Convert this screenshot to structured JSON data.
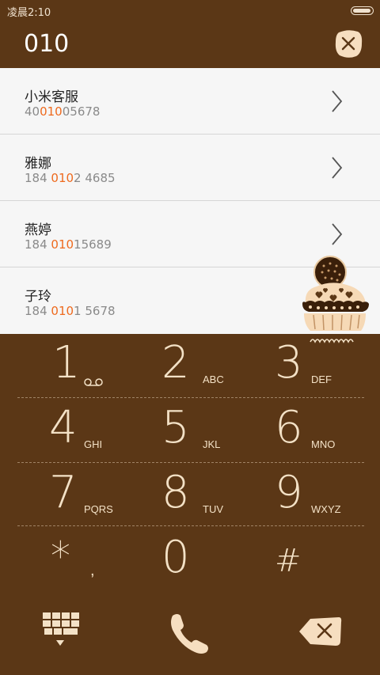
{
  "status": {
    "time": "凌晨2:10"
  },
  "search": {
    "query": "010"
  },
  "results": [
    {
      "name": "小米客服",
      "number_pre": "40",
      "number_match": "010",
      "number_post": "05678"
    },
    {
      "name": "雅娜",
      "number_pre": "184 ",
      "number_match": "010",
      "number_post": "2 4685"
    },
    {
      "name": "燕婷",
      "number_pre": "184 ",
      "number_match": "010",
      "number_post": "15689"
    },
    {
      "name": "子玲",
      "number_pre": "184 ",
      "number_match": "010",
      "number_post": "1 5678"
    }
  ],
  "keypad": {
    "k1": {
      "digit": "1",
      "letters": ""
    },
    "k2": {
      "digit": "2",
      "letters": "ABC"
    },
    "k3": {
      "digit": "3",
      "letters": "DEF"
    },
    "k4": {
      "digit": "4",
      "letters": "GHI"
    },
    "k5": {
      "digit": "5",
      "letters": "JKL"
    },
    "k6": {
      "digit": "6",
      "letters": "MNO"
    },
    "k7": {
      "digit": "7",
      "letters": "PQRS"
    },
    "k8": {
      "digit": "8",
      "letters": "TUV"
    },
    "k9": {
      "digit": "9",
      "letters": "WXYZ"
    },
    "kstar": {
      "symbol": "*",
      "sub": ","
    },
    "k0": {
      "digit": "0"
    },
    "khash": {
      "symbol": "#"
    }
  },
  "theme": {
    "background": "#5b3716",
    "key_text": "#f3e1c6",
    "highlight": "#ee6a1e",
    "list_bg": "#f6f6f6"
  },
  "icons": [
    "voicemail-icon",
    "close-icon",
    "chevron-right-icon",
    "dialpad-toggle-icon",
    "phone-icon",
    "backspace-icon",
    "cupcake-decoration"
  ]
}
